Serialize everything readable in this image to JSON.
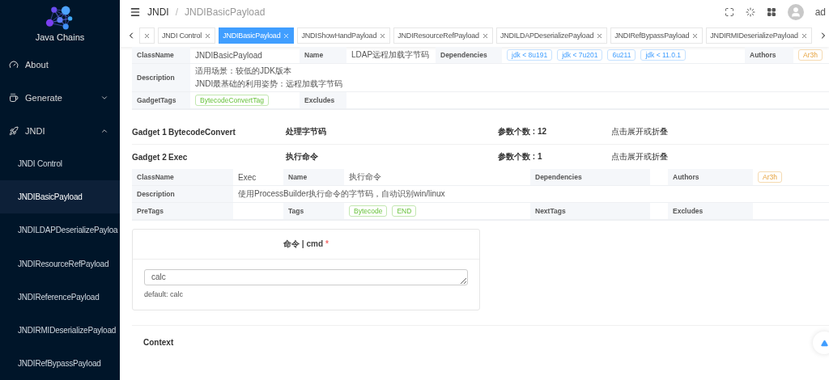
{
  "sidebar": {
    "logo_text": "Java Chains",
    "items": [
      {
        "label": "About",
        "selected": false
      },
      {
        "label": "Generate",
        "selected": false,
        "expanded": false
      },
      {
        "label": "JNDI",
        "selected": false,
        "expanded": true,
        "children": [
          {
            "label": "JNDI Control",
            "selected": false
          },
          {
            "label": "JNDIBasicPayload",
            "selected": true
          },
          {
            "label": "JNDILDAPDeserializePayloa",
            "selected": false
          },
          {
            "label": "JNDIResourceRefPayload",
            "selected": false
          },
          {
            "label": "JNDIReferencePayload",
            "selected": false
          },
          {
            "label": "JNDIRMIDeserializePayload",
            "selected": false
          },
          {
            "label": "JNDIRefBypassPayload",
            "selected": false
          }
        ]
      }
    ]
  },
  "header": {
    "breadcrumb": [
      "JNDI",
      "JNDIBasicPayload"
    ],
    "separator": "/",
    "user": "ad"
  },
  "tabs": [
    {
      "selected": false
    },
    {
      "label": "JNDI Control",
      "selected": false
    },
    {
      "label": "JNDIBasicPayload",
      "selected": true
    },
    {
      "label": "JNDIShowHandPayload",
      "selected": false
    },
    {
      "label": "JNDIResourceRefPayload",
      "selected": false
    },
    {
      "label": "JNDILDAPDeserializePayload",
      "selected": false
    },
    {
      "label": "JNDIRefBypassPayload",
      "selected": false
    },
    {
      "label": "JNDIRMIDeserializePayload",
      "selected": false
    }
  ],
  "payload": {
    "class_name_label": "ClassName",
    "class_name": "JNDIBasicPayload",
    "name_label": "Name",
    "name": "LDAP远程加载字节码",
    "dependencies_label": "Dependencies",
    "dependencies": [
      "jdk < 8u191",
      "jdk < 7u201",
      "6u211",
      "jdk < 11.0.1"
    ],
    "authors_label": "Authors",
    "authors": [
      "Ar3h"
    ],
    "description_label": "Description",
    "description": [
      "适用场景：较低的JDK版本",
      "JNDI最基础的利用姿势：远程加载字节码"
    ],
    "gadget_tags_label": "GadgetTags",
    "gadget_tags": [
      "BytecodeConvertTag"
    ],
    "excludes_label": "Excludes"
  },
  "gadgets": [
    {
      "label": "Gadget 1",
      "name": "BytecodeConvert",
      "title": "处理字节码",
      "params": "参数个数 : 12",
      "toggle": "点击展开或折叠",
      "expanded": false
    },
    {
      "label": "Gadget 2",
      "name": "Exec",
      "title": "执行命令",
      "params": "参数个数 : 1",
      "toggle": "点击展开或折叠",
      "expanded": true,
      "detail": {
        "class_name_label": "ClassName",
        "class_name": "Exec",
        "name_label": "Name",
        "name": "执行命令",
        "dependencies_label": "Dependencies",
        "authors_label": "Authors",
        "authors": [
          "Ar3h"
        ],
        "description_label": "Description",
        "description": "使用ProcessBuilder执行命令的字节码，自动识别win/linux",
        "pre_tags_label": "PreTags",
        "tags_label": "Tags",
        "tags": [
          "Bytecode",
          "END"
        ],
        "next_tags_label": "NextTags",
        "excludes_label": "Excludes"
      },
      "param": {
        "title": "命令 | cmd",
        "required": true,
        "required_mark": "*",
        "value": "calc",
        "hint": "default: calc"
      }
    }
  ],
  "context": {
    "title": "Context"
  }
}
